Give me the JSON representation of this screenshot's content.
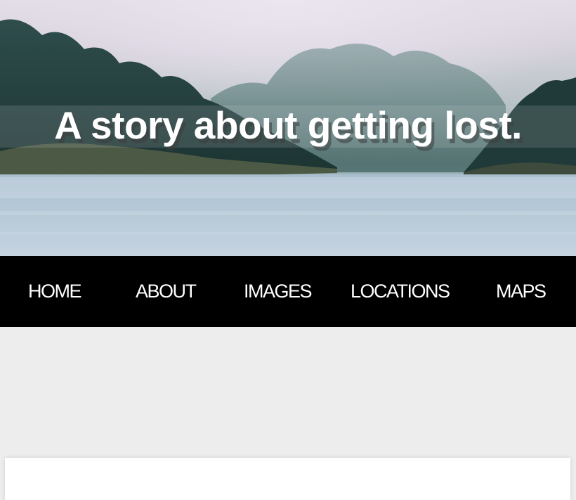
{
  "hero": {
    "title": "A story about getting lost.",
    "image": "misty forested islands over a calm lake"
  },
  "nav": {
    "items": [
      {
        "label": "HOME"
      },
      {
        "label": "ABOUT"
      },
      {
        "label": "IMAGES"
      },
      {
        "label": "LOCATIONS"
      },
      {
        "label": "MAPS"
      }
    ]
  },
  "colors": {
    "nav_background": "#000000",
    "nav_text": "#ffffff",
    "page_background": "#ededed",
    "card_background": "#ffffff",
    "title_text": "#ffffff"
  }
}
